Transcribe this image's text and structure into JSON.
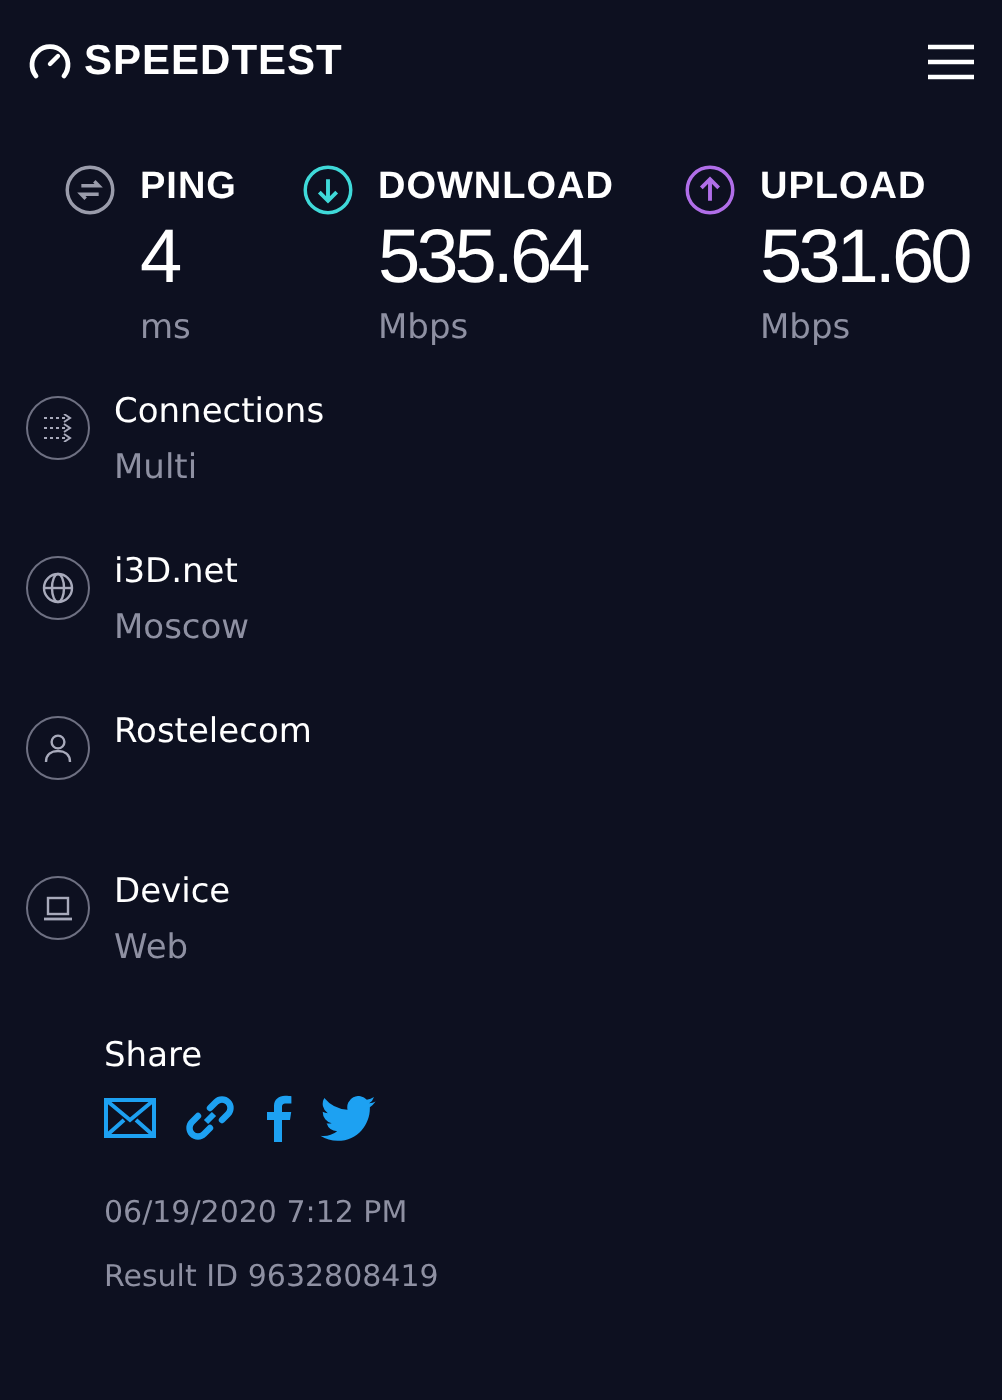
{
  "header": {
    "logo": "SPEEDTEST"
  },
  "metrics": [
    {
      "kind": "ping",
      "label": "PING",
      "value": "4",
      "unit": "ms",
      "color": "#9a9cab"
    },
    {
      "kind": "download",
      "label": "DOWNLOAD",
      "value": "535.64",
      "unit": "Mbps",
      "color": "#3fd9d9"
    },
    {
      "kind": "upload",
      "label": "UPLOAD",
      "value": "531.60",
      "unit": "Mbps",
      "color": "#b06ee8"
    }
  ],
  "details": [
    {
      "kind": "connections",
      "title": "Connections",
      "subtitle": "Multi"
    },
    {
      "kind": "server",
      "title": "i3D.net",
      "subtitle": "Moscow"
    },
    {
      "kind": "provider",
      "title": "Rostelecom"
    },
    {
      "kind": "device",
      "title": "Device",
      "subtitle": "Web"
    }
  ],
  "share": {
    "label": "Share",
    "targets": [
      {
        "kind": "email"
      },
      {
        "kind": "link"
      },
      {
        "kind": "facebook"
      },
      {
        "kind": "twitter"
      }
    ]
  },
  "date": "06/19/2020 7:12 PM",
  "result_id": "Result ID 9632808419"
}
